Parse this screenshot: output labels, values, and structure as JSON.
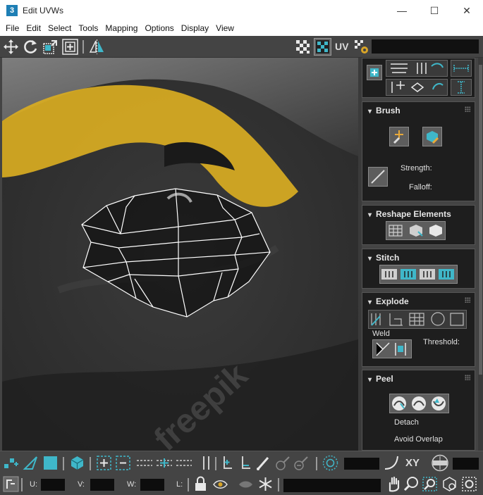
{
  "window": {
    "app_icon_text": "3",
    "title": "Edit UVWs",
    "minimize_glyph": "—",
    "maximize_glyph": "☐",
    "close_glyph": "✕"
  },
  "menu": [
    {
      "label": "File"
    },
    {
      "label": "Edit"
    },
    {
      "label": "Select"
    },
    {
      "label": "Tools"
    },
    {
      "label": "Mapping"
    },
    {
      "label": "Options"
    },
    {
      "label": "Display"
    },
    {
      "label": "View"
    }
  ],
  "toolbar": {
    "uv_label": "UV",
    "icons": [
      "move-icon",
      "rotate-icon",
      "scale-icon",
      "freeform-icon",
      "mirror-icon",
      "checker-pattern-icon",
      "show-map-icon",
      "uv-settings-icon"
    ]
  },
  "viewport": {
    "watermark": "freepik"
  },
  "panel": {
    "brush": {
      "title": "Brush",
      "strength_label": "Strength:",
      "falloff_label": "Falloff:"
    },
    "reshape": {
      "title": "Reshape Elements"
    },
    "stitch": {
      "title": "Stitch"
    },
    "explode": {
      "title": "Explode",
      "weld_label": "Weld",
      "threshold_label": "Threshold:"
    },
    "peel": {
      "title": "Peel",
      "detach_label": "Detach",
      "avoid_overlap_label": "Avoid Overlap"
    }
  },
  "bottom": {
    "xy_label": "XY",
    "u_label": "U:",
    "v_label": "V:",
    "w_label": "W:",
    "l_label": "L:"
  },
  "colors": {
    "accent_cyan": "#3fb7c9",
    "panel_bg": "#1e1e1e",
    "window_bg": "#444444",
    "mesh_stroke": "#ffffff",
    "eye_ring_yellow": "#d9ac22"
  }
}
